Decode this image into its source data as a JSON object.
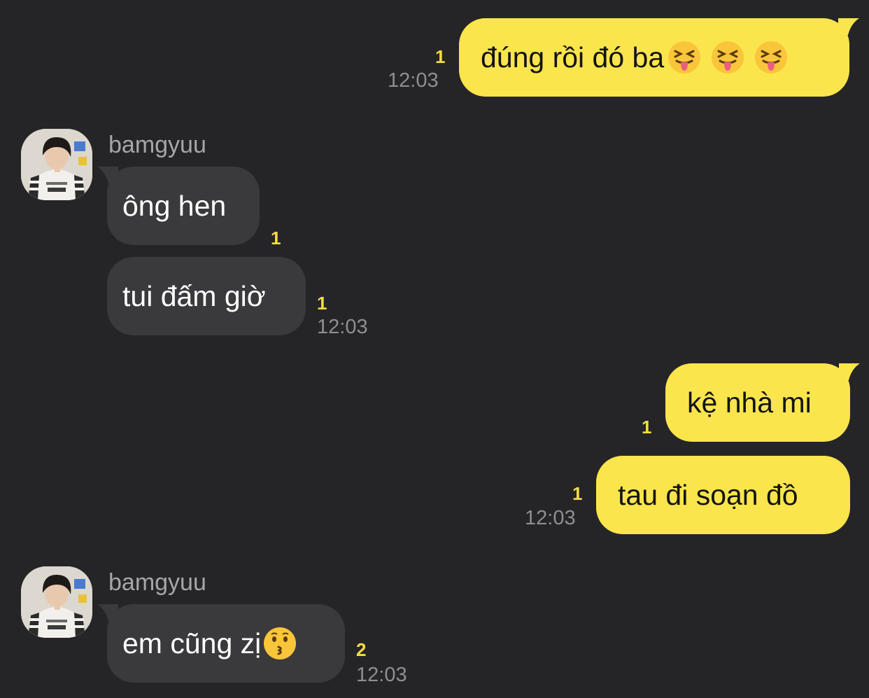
{
  "chat": {
    "contact_name": "bamgyuu",
    "messages": [
      {
        "direction": "out",
        "text": "đúng rồi đó ba",
        "emoji": [
          "squinting-tongue-emoji",
          "squinting-tongue-emoji",
          "squinting-tongue-emoji"
        ],
        "unread": "1",
        "time": "12:03"
      },
      {
        "direction": "in",
        "sender": "bamgyuu",
        "text": "ông hen",
        "unread": "1",
        "time": ""
      },
      {
        "direction": "in",
        "text": "tui đấm giờ",
        "unread": "1",
        "time": "12:03"
      },
      {
        "direction": "out",
        "text": "kệ nhà mi",
        "unread": "1",
        "time": ""
      },
      {
        "direction": "out",
        "text": "tau đi soạn đồ",
        "unread": "1",
        "time": "12:03"
      },
      {
        "direction": "in",
        "sender": "bamgyuu",
        "text": "em cũng zị",
        "emoji": [
          "kissing-emoji"
        ],
        "unread": "2",
        "time": "12:03"
      }
    ]
  },
  "colors": {
    "background": "#252527",
    "outgoing_bubble": "#fbe54d",
    "incoming_bubble": "#3a3a3c",
    "unread_count": "#f7dd3f",
    "timestamp": "#8e8e93",
    "sender_name": "#a6a6aa"
  }
}
